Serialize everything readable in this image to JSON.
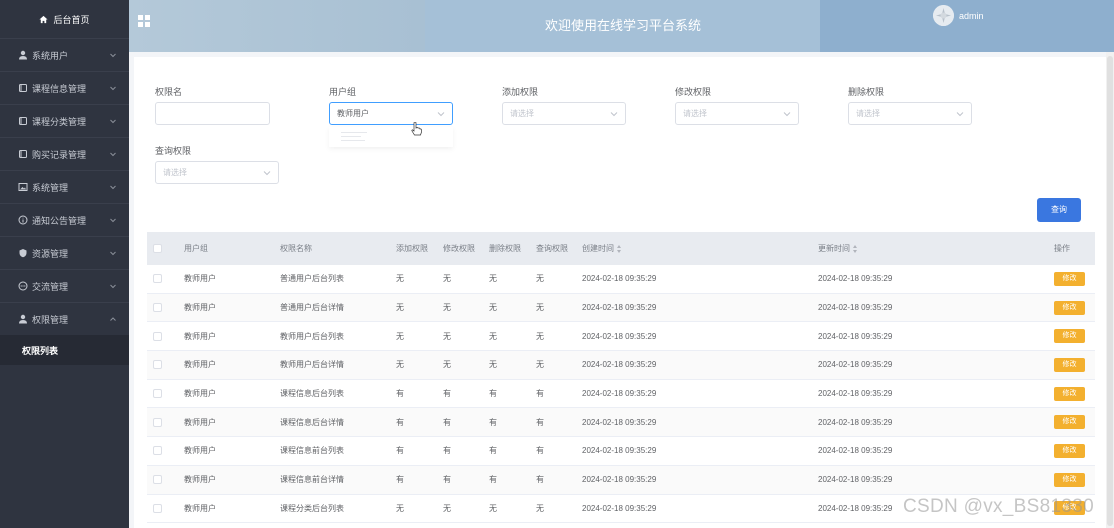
{
  "sidebar": {
    "home_label": "后台首页",
    "items": [
      {
        "label": "系统用户",
        "icon": "user-icon"
      },
      {
        "label": "课程信息管理",
        "icon": "book-icon"
      },
      {
        "label": "课程分类管理",
        "icon": "book-icon"
      },
      {
        "label": "购买记录管理",
        "icon": "book-icon"
      },
      {
        "label": "系统管理",
        "icon": "image-icon"
      },
      {
        "label": "通知公告管理",
        "icon": "info-icon"
      },
      {
        "label": "资源管理",
        "icon": "shield-icon"
      },
      {
        "label": "交流管理",
        "icon": "chat-icon"
      },
      {
        "label": "权限管理",
        "icon": "user-icon"
      }
    ],
    "active_sub": "权限列表"
  },
  "header": {
    "title": "欢迎使用在线学习平台系统",
    "username": "admin"
  },
  "filters": {
    "permission_name_label": "权限名",
    "permission_name_value": "",
    "user_group_label": "用户组",
    "user_group_value": "教师用户",
    "add_label": "添加权限",
    "add_placeholder": "请选择",
    "edit_label": "修改权限",
    "edit_placeholder": "请选择",
    "delete_label": "删除权限",
    "delete_placeholder": "请选择",
    "query_label": "查询权限",
    "query_placeholder": "请选择",
    "search_button": "查询"
  },
  "table": {
    "headers": [
      "用户组",
      "权限名称",
      "添加权限",
      "修改权限",
      "删除权限",
      "查询权限",
      "创建时间",
      "更新时间",
      "操作"
    ],
    "edit_label": "修改",
    "rows": [
      [
        "教师用户",
        "普通用户后台列表",
        "无",
        "无",
        "无",
        "无",
        "2024-02-18 09:35:29",
        "2024-02-18 09:35:29"
      ],
      [
        "教师用户",
        "普通用户后台详情",
        "无",
        "无",
        "无",
        "无",
        "2024-02-18 09:35:29",
        "2024-02-18 09:35:29"
      ],
      [
        "教师用户",
        "教师用户后台列表",
        "无",
        "无",
        "无",
        "无",
        "2024-02-18 09:35:29",
        "2024-02-18 09:35:29"
      ],
      [
        "教师用户",
        "教师用户后台详情",
        "无",
        "无",
        "无",
        "无",
        "2024-02-18 09:35:29",
        "2024-02-18 09:35:29"
      ],
      [
        "教师用户",
        "课程信息后台列表",
        "有",
        "有",
        "有",
        "有",
        "2024-02-18 09:35:29",
        "2024-02-18 09:35:29"
      ],
      [
        "教师用户",
        "课程信息后台详情",
        "有",
        "有",
        "有",
        "有",
        "2024-02-18 09:35:29",
        "2024-02-18 09:35:29"
      ],
      [
        "教师用户",
        "课程信息前台列表",
        "有",
        "有",
        "有",
        "有",
        "2024-02-18 09:35:29",
        "2024-02-18 09:35:29"
      ],
      [
        "教师用户",
        "课程信息前台详情",
        "有",
        "有",
        "有",
        "有",
        "2024-02-18 09:35:29",
        "2024-02-18 09:35:29"
      ],
      [
        "教师用户",
        "课程分类后台列表",
        "无",
        "无",
        "无",
        "无",
        "2024-02-18 09:35:29",
        "2024-02-18 09:35:29"
      ]
    ]
  },
  "watermark": "CSDN @vx_BS81330"
}
